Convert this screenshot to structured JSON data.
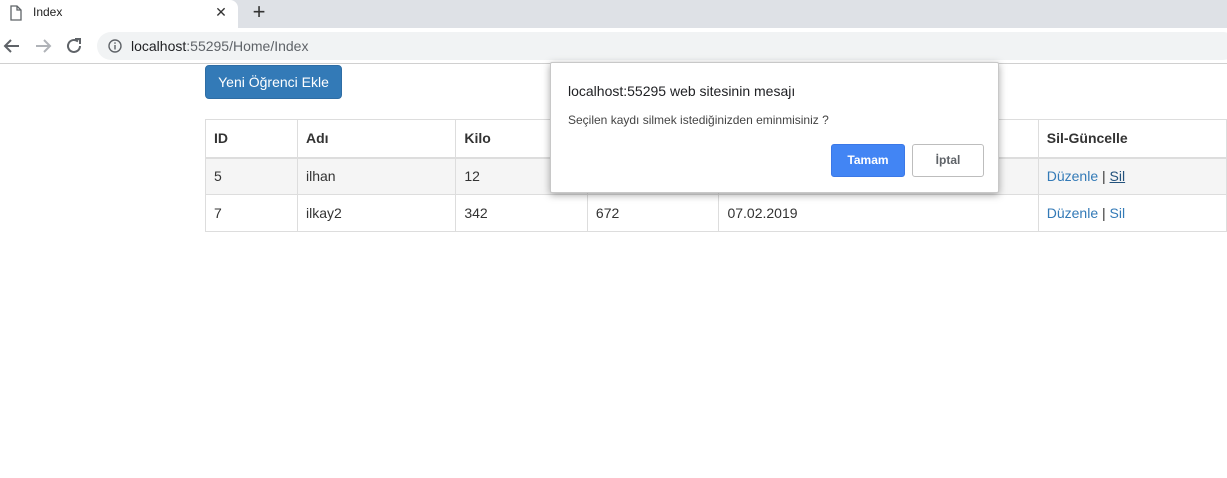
{
  "browser": {
    "tab_title": "Index",
    "tab_close": "✕",
    "new_tab": "+",
    "url_host": "localhost",
    "url_rest": ":55295/Home/Index"
  },
  "page": {
    "add_button_label": "Yeni Öğrenci Ekle",
    "table": {
      "headers": [
        "ID",
        "Adı",
        "Kilo",
        "",
        "",
        "Sil-Güncelle"
      ],
      "rows": [
        {
          "id": "5",
          "name": "ilhan",
          "kilo": "12",
          "col4": "",
          "date": "",
          "edit": "Düzenle",
          "sep": "|",
          "delete": "Sil"
        },
        {
          "id": "7",
          "name": "ilkay2",
          "kilo": "342",
          "col4": "672",
          "date": "07.02.2019",
          "edit": "Düzenle",
          "sep": "|",
          "delete": "Sil"
        }
      ]
    }
  },
  "dialog": {
    "title": "localhost:55295 web sitesinin mesajı",
    "message": "Seçilen kaydı silmek istediğinizden eminmisiniz ?",
    "ok_label": "Tamam",
    "cancel_label": "İptal"
  },
  "colors": {
    "primary": "#337ab7",
    "dialog_ok": "#4285f4",
    "chrome_tabstrip": "#dee1e6"
  }
}
